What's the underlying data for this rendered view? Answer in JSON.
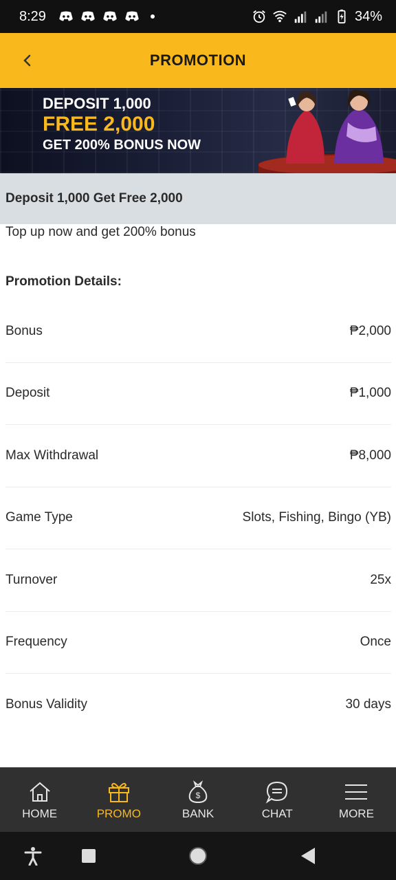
{
  "status_bar": {
    "time": "8:29",
    "battery": "34%",
    "notification_icons": [
      "discord-icon",
      "discord-icon",
      "discord-icon",
      "discord-icon"
    ]
  },
  "header": {
    "title": "PROMOTION"
  },
  "banner": {
    "line1": "DEPOSIT 1,000",
    "line2": "FREE 2,000",
    "line3": "GET 200% BONUS NOW"
  },
  "promotion": {
    "title": "Deposit 1,000 Get Free 2,000",
    "description": "Top up now and get 200% bonus",
    "details_heading": "Promotion Details:",
    "details": [
      {
        "label": "Bonus",
        "value": "₱2,000"
      },
      {
        "label": "Deposit",
        "value": "₱1,000"
      },
      {
        "label": "Max Withdrawal",
        "value": "₱8,000"
      },
      {
        "label": "Game Type",
        "value": "Slots, Fishing, Bingo (YB)"
      },
      {
        "label": "Turnover",
        "value": "25x"
      },
      {
        "label": "Frequency",
        "value": "Once"
      },
      {
        "label": "Bonus Validity",
        "value": "30 days"
      }
    ]
  },
  "bottom_nav": {
    "items": [
      {
        "label": "HOME",
        "icon": "home-icon",
        "active": false
      },
      {
        "label": "PROMO",
        "icon": "gift-icon",
        "active": true
      },
      {
        "label": "BANK",
        "icon": "money-bag-icon",
        "active": false
      },
      {
        "label": "CHAT",
        "icon": "chat-icon",
        "active": false
      },
      {
        "label": "MORE",
        "icon": "menu-icon",
        "active": false
      }
    ]
  },
  "colors": {
    "accent": "#F9B81B",
    "title_bar_bg": "#D9DEE2",
    "nav_bg": "#303030"
  }
}
